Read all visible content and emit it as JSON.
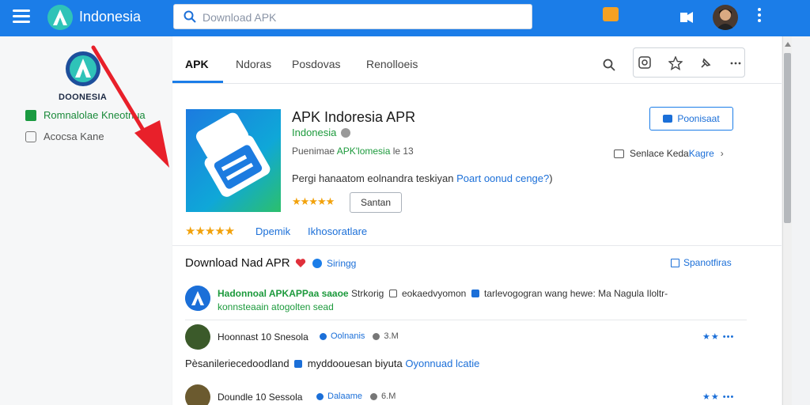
{
  "header": {
    "brand": "Indonesia",
    "search_placeholder": "Download APK",
    "icons": [
      "menu-icon",
      "search-icon",
      "notification-icon",
      "share-icon",
      "avatar",
      "more-icon"
    ],
    "accent_color": "#1b7de8"
  },
  "sidebar": {
    "logo_text": "DOONESIA",
    "items": [
      {
        "label": "Romnalolae Kneotnua",
        "checked": true
      },
      {
        "label": "Acocsa Kane",
        "checked": false
      }
    ]
  },
  "tabs": [
    {
      "label": "APK",
      "active": true
    },
    {
      "label": "Ndoras",
      "active": false
    },
    {
      "label": "Posdovas",
      "active": false
    },
    {
      "label": "Renolloeis",
      "active": false
    }
  ],
  "app": {
    "title": "APK Indoresia APR",
    "developer": "Indonesia",
    "meta_prefix": "Puenimae ",
    "meta_highlight": "APK'lomesia",
    "meta_suffix": " le 13",
    "desc_prefix": "Pergi hanaatom eolnandra teskiyan ",
    "desc_highlight": "Poart oonud cenge?",
    "desc_suffix": ")",
    "stars_small": "★★★★★",
    "chip_label": "Santan",
    "install_label": "Poonisaat",
    "similar_prefix": "Senlace Keda ",
    "similar_highlight": "Kagre",
    "rating_stars": "★★★★★",
    "rating_link1": "Dpemik",
    "rating_link2": "Ikhosoratlare"
  },
  "download": {
    "title": "Download Nad APR",
    "rating_label": "Siringg",
    "share_label": "Spanotfiras",
    "row1_highlight": "Hadonnoal APKAPPaa saaoe",
    "row1_text": " Strkorig ",
    "row1_text2": " eokaedvyomon ",
    "row1_text3": " tarlevogogran wang hewe: Ma Nagula Iloltr-",
    "row1_line2": "konnsteaain atogolten sead",
    "comments": [
      {
        "name": "Hoonnast 10 Snesola",
        "meta1": "Oolnanis",
        "meta2": "3.M"
      },
      {
        "name": "Doundle 10 Sessola",
        "meta1": "Dalaame",
        "meta2": "6.M"
      }
    ],
    "comment_actions": "★★ •••",
    "review_prefix": "Pèsanileriecedoodland ",
    "review_mid": " myddoouesan biyuta ",
    "review_highlight": "Oyonnuad lcatie"
  }
}
